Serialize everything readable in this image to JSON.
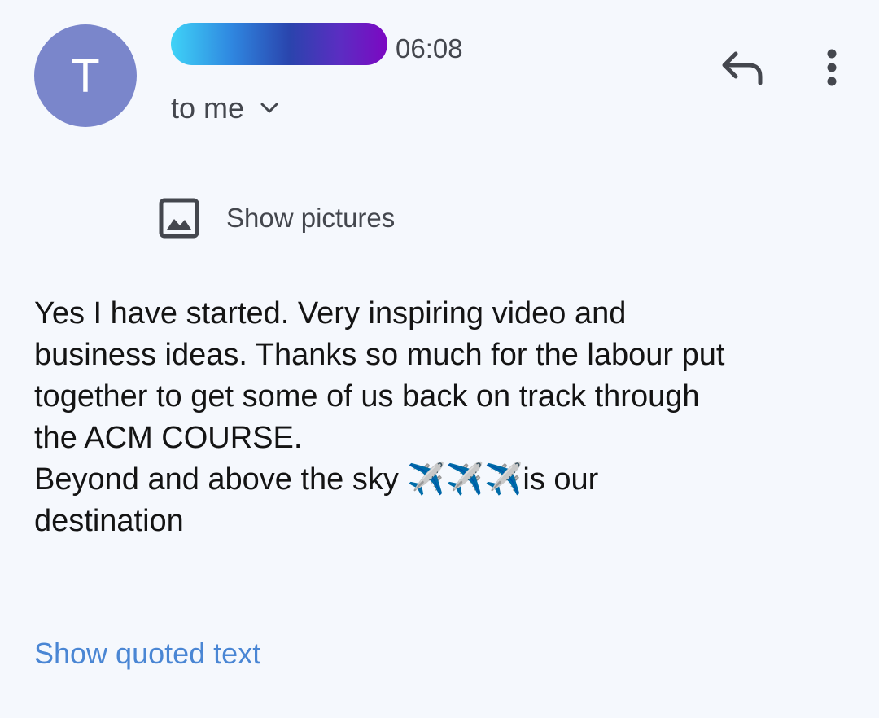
{
  "sender": {
    "avatar_initial": "T",
    "time": "06:08",
    "recipient_label": "to me"
  },
  "icons": {
    "recipient_toggle": "chevron-down-icon",
    "reply": "reply-icon",
    "more": "more-vert-icon",
    "show_pictures": "image-icon"
  },
  "actions": {
    "show_pictures_label": "Show pictures",
    "show_quoted_label": "Show quoted text"
  },
  "message": {
    "body": "Yes I have started. Very inspiring video and\nbusiness ideas. Thanks so much for the labour put\ntogether to get some of us back on track through\nthe ACM COURSE.\nBeyond and above the sky ✈️✈️✈️is our\ndestination"
  },
  "colors": {
    "avatar": "#7a86cb",
    "link": "#4a86d4",
    "background": "#f5f8fd"
  }
}
